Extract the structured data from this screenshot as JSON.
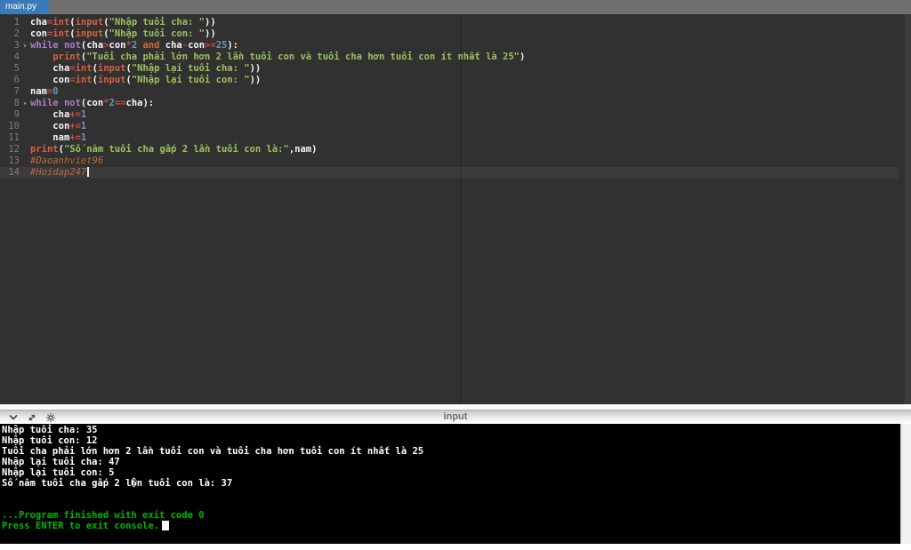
{
  "colors": {
    "tab_active_bg": "#3b7ab9",
    "tab_bar_bg": "#707070",
    "editor_bg": "#313131",
    "console_bg": "#000000",
    "console_text": "#ffffff",
    "console_status_green": "#00b800",
    "syntax_keyword": "#ad7fc4",
    "syntax_operator": "#cb4b42",
    "syntax_builtin": "#d8603f",
    "syntax_string": "#9dc15c",
    "syntax_number": "#6897bb",
    "syntax_comment": "#b5683b"
  },
  "tab_bar": {
    "active_tab": "main.py"
  },
  "editor": {
    "lines": [
      {
        "no": "1",
        "fold": false,
        "active": false,
        "tokens": [
          [
            "id",
            "cha"
          ],
          [
            "op",
            "="
          ],
          [
            "fn",
            "int"
          ],
          [
            "p",
            "("
          ],
          [
            "fn",
            "input"
          ],
          [
            "p",
            "("
          ],
          [
            "str",
            "\"Nhập tuổi cha: \""
          ],
          [
            "p",
            "))"
          ]
        ]
      },
      {
        "no": "2",
        "fold": false,
        "active": false,
        "tokens": [
          [
            "id",
            "con"
          ],
          [
            "op",
            "="
          ],
          [
            "fn",
            "int"
          ],
          [
            "p",
            "("
          ],
          [
            "fn",
            "input"
          ],
          [
            "p",
            "("
          ],
          [
            "str",
            "\"Nhập tuổi con: \""
          ],
          [
            "p",
            "))"
          ]
        ]
      },
      {
        "no": "3",
        "fold": true,
        "active": false,
        "tokens": [
          [
            "kw",
            "while"
          ],
          [
            "p",
            " "
          ],
          [
            "kw",
            "not"
          ],
          [
            "p",
            "("
          ],
          [
            "id",
            "cha"
          ],
          [
            "op",
            ">"
          ],
          [
            "id",
            "con"
          ],
          [
            "op",
            "*"
          ],
          [
            "num",
            "2"
          ],
          [
            "p",
            " "
          ],
          [
            "kwo",
            "and"
          ],
          [
            "p",
            " "
          ],
          [
            "id",
            "cha"
          ],
          [
            "op",
            "-"
          ],
          [
            "id",
            "con"
          ],
          [
            "op",
            ">="
          ],
          [
            "num",
            "25"
          ],
          [
            "p",
            "):"
          ]
        ]
      },
      {
        "no": "4",
        "fold": false,
        "active": false,
        "tokens": [
          [
            "p",
            "    "
          ],
          [
            "fn",
            "print"
          ],
          [
            "p",
            "("
          ],
          [
            "str",
            "\"Tuổi cha phải lớn hơn 2 lần tuổi con và tuổi cha hơn tuổi con ít nhất là 25\""
          ],
          [
            "p",
            ")"
          ]
        ]
      },
      {
        "no": "5",
        "fold": false,
        "active": false,
        "tokens": [
          [
            "p",
            "    "
          ],
          [
            "id",
            "cha"
          ],
          [
            "op",
            "="
          ],
          [
            "fn",
            "int"
          ],
          [
            "p",
            "("
          ],
          [
            "fn",
            "input"
          ],
          [
            "p",
            "("
          ],
          [
            "str",
            "\"Nhập lại tuổi cha: \""
          ],
          [
            "p",
            "))"
          ]
        ]
      },
      {
        "no": "6",
        "fold": false,
        "active": false,
        "tokens": [
          [
            "p",
            "    "
          ],
          [
            "id",
            "con"
          ],
          [
            "op",
            "="
          ],
          [
            "fn",
            "int"
          ],
          [
            "p",
            "("
          ],
          [
            "fn",
            "input"
          ],
          [
            "p",
            "("
          ],
          [
            "str",
            "\"Nhập lại tuổi con: \""
          ],
          [
            "p",
            "))"
          ]
        ]
      },
      {
        "no": "7",
        "fold": false,
        "active": false,
        "tokens": [
          [
            "id",
            "nam"
          ],
          [
            "op",
            "="
          ],
          [
            "num",
            "0"
          ]
        ]
      },
      {
        "no": "8",
        "fold": true,
        "active": false,
        "tokens": [
          [
            "kw",
            "while"
          ],
          [
            "p",
            " "
          ],
          [
            "kw",
            "not"
          ],
          [
            "p",
            "("
          ],
          [
            "id",
            "con"
          ],
          [
            "op",
            "*"
          ],
          [
            "num",
            "2"
          ],
          [
            "op",
            "=="
          ],
          [
            "id",
            "cha"
          ],
          [
            "p",
            "):"
          ]
        ]
      },
      {
        "no": "9",
        "fold": false,
        "active": false,
        "tokens": [
          [
            "p",
            "    "
          ],
          [
            "id",
            "cha"
          ],
          [
            "op",
            "+="
          ],
          [
            "num",
            "1"
          ]
        ]
      },
      {
        "no": "10",
        "fold": false,
        "active": false,
        "tokens": [
          [
            "p",
            "    "
          ],
          [
            "id",
            "con"
          ],
          [
            "op",
            "+="
          ],
          [
            "num",
            "1"
          ]
        ]
      },
      {
        "no": "11",
        "fold": false,
        "active": false,
        "tokens": [
          [
            "p",
            "    "
          ],
          [
            "id",
            "nam"
          ],
          [
            "op",
            "+="
          ],
          [
            "num",
            "1"
          ]
        ]
      },
      {
        "no": "12",
        "fold": false,
        "active": false,
        "tokens": [
          [
            "fn",
            "print"
          ],
          [
            "p",
            "("
          ],
          [
            "str",
            "\"Số năm tuổi cha gấp 2 lần tuổi con là:\""
          ],
          [
            "p",
            ","
          ],
          [
            "id",
            "nam"
          ],
          [
            "p",
            ")"
          ]
        ]
      },
      {
        "no": "13",
        "fold": false,
        "active": false,
        "tokens": [
          [
            "com",
            "#Daoanhviet96"
          ]
        ]
      },
      {
        "no": "14",
        "fold": false,
        "active": true,
        "tokens": [
          [
            "com",
            "#Hoidap247"
          ]
        ]
      }
    ]
  },
  "console": {
    "header": {
      "label": "input",
      "icons": [
        "chevron-down-icon",
        "expand-icon",
        "gear-icon"
      ]
    },
    "lines": [
      {
        "text": "Nhập tuổi cha: 35",
        "style": "plain"
      },
      {
        "text": "Nhập tuổi con: 12",
        "style": "plain"
      },
      {
        "text": "Tuổi cha phải lớn hơn 2 lần tuổi con và tuổi cha hơn tuổi con ít nhất là 25",
        "style": "plain"
      },
      {
        "text": "Nhập lại tuổi cha: 47",
        "style": "plain"
      },
      {
        "text": "Nhập lại tuổi con: 5",
        "style": "plain"
      },
      {
        "text": "Số năm tuổi cha gấp 2 l�n tuổi con là: 37",
        "style": "plain"
      },
      {
        "text": "",
        "style": "plain"
      },
      {
        "text": "",
        "style": "plain"
      },
      {
        "text": "...Program finished with exit code 0",
        "style": "status"
      },
      {
        "text": "Press ENTER to exit console.",
        "style": "status",
        "cursor": true
      }
    ]
  }
}
